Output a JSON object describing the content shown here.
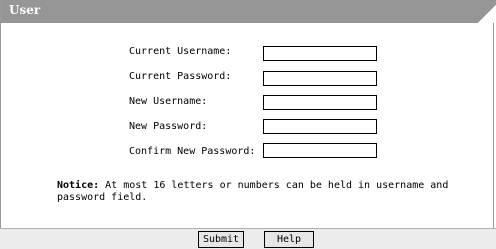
{
  "panel": {
    "title": "User"
  },
  "form": {
    "fields": [
      {
        "label": "Current Username:",
        "value": ""
      },
      {
        "label": "Current Password:",
        "value": ""
      },
      {
        "label": "New Username:",
        "value": ""
      },
      {
        "label": "New Password:",
        "value": ""
      },
      {
        "label": "Confirm New Password:",
        "value": ""
      }
    ]
  },
  "notice": {
    "prefix": "Notice:",
    "text": " At most 16 letters or numbers can be held in username and password field."
  },
  "buttons": {
    "submit": "Submit",
    "help": "Help"
  },
  "colors": {
    "titlebar": "#969696",
    "background": "#ffffff"
  }
}
